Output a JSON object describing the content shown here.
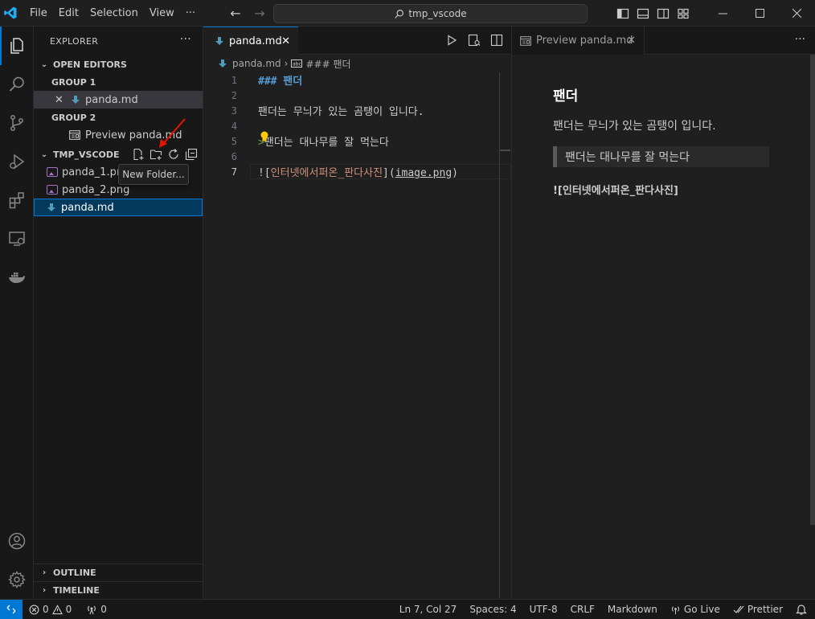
{
  "titlebar": {
    "menu": [
      "File",
      "Edit",
      "Selection",
      "View",
      "···"
    ],
    "search": "tmp_vscode"
  },
  "sidebar": {
    "title": "EXPLORER",
    "more": "···",
    "open_editors": "OPEN EDITORS",
    "group1": "GROUP 1",
    "group1_file": "panda.md",
    "group2": "GROUP 2",
    "group2_file": "Preview panda.md",
    "folder": "TMP_VSCODE",
    "files": [
      "panda_1.png",
      "panda_2.png",
      "panda.md"
    ],
    "tooltip": "New Folder...",
    "outline": "OUTLINE",
    "timeline": "TIMELINE"
  },
  "editor": {
    "tab": "panda.md",
    "breadcrumb_file": "panda.md",
    "breadcrumb_symbol": "### 팬더",
    "lines": {
      "l1": "### 팬더",
      "l3": "팬더는 무늬가 있는 곰탱이 입니다.",
      "l5_mark": ">",
      "l5": "팬더는 대나무를 잘 먹는다",
      "l7_open": "![",
      "l7_alt": "인터넷에서퍼온_판다사진",
      "l7_mid": "](",
      "l7_url": "image.png",
      "l7_close": ")"
    },
    "line_numbers": [
      "1",
      "2",
      "3",
      "4",
      "5",
      "6",
      "7"
    ]
  },
  "preview": {
    "tab": "Preview panda.md",
    "more": "···",
    "heading": "팬더",
    "paragraph": "팬더는 무늬가 있는 곰탱이 입니다.",
    "quote": "팬더는 대나무를 잘 먹는다",
    "image_alt": "![인터넷에서퍼온_판다사진]"
  },
  "status": {
    "errors": "0",
    "warnings": "0",
    "ports": "0",
    "position": "Ln 7, Col 27",
    "spaces": "Spaces: 4",
    "encoding": "UTF-8",
    "eol": "CRLF",
    "language": "Markdown",
    "golive": "Go Live",
    "prettier": "Prettier"
  },
  "colors": {
    "accent": "#0078d4",
    "markdown_icon": "#519aba",
    "heading": "#569cd6",
    "link_text": "#ce9178"
  }
}
